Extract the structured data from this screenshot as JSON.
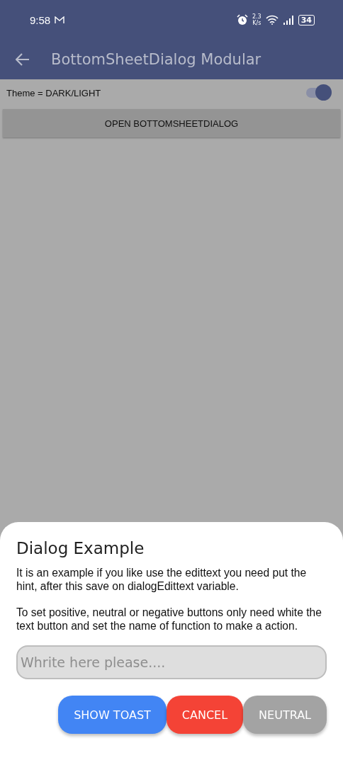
{
  "status_bar": {
    "time": "9:58",
    "speed_value": "2.3",
    "speed_unit": "K/s",
    "battery": "34"
  },
  "app_bar": {
    "title": "BottomSheetDialog Modular"
  },
  "theme_row": {
    "label": "Theme = DARK/LIGHT",
    "switch_on": true
  },
  "open_button": {
    "label": "OPEN BOTTOMSHEETDIALOG"
  },
  "dialog": {
    "title": "Dialog Example",
    "paragraphs": [
      "It is an example if you like use the edittext you need put the hint, after this save on  dialogEdittext variable.",
      "To set positive, neutral or negative buttons only need white the text button and set the name of function to make a action."
    ],
    "field": {
      "placeholder": "Whrite here please...."
    },
    "buttons": [
      {
        "label": "SHOW TOAST",
        "color": "#4285f4"
      },
      {
        "label": "CANCEL",
        "color": "#f44336"
      },
      {
        "label": "NEUTRAL",
        "color": "#a3a3a3"
      }
    ]
  }
}
